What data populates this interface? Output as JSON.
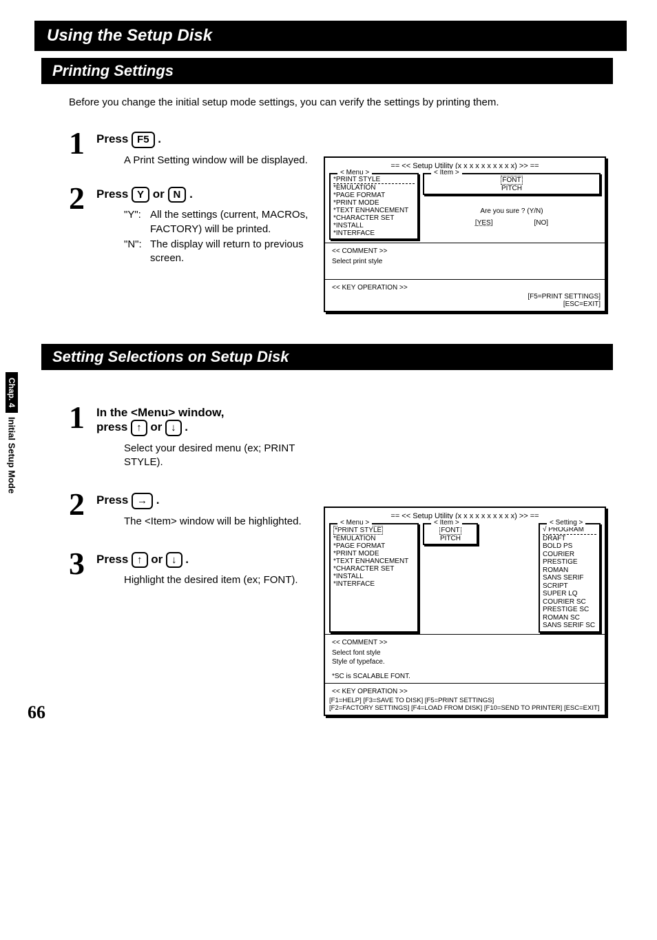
{
  "header": {
    "title": "Using the Setup Disk"
  },
  "sideTab": {
    "chap": "Chap. 4",
    "section": "Initial Setup Mode"
  },
  "pageNumber": "66",
  "section1": {
    "title": "Printing Settings",
    "intro": "Before you change the initial setup mode settings, you can verify the settings by printing them.",
    "step1": {
      "num": "1",
      "headPrefix": "Press ",
      "key": "F5",
      "headSuffix": " .",
      "desc": "A Print Setting window will be displayed."
    },
    "step2": {
      "num": "2",
      "headPrefix": "Press ",
      "keyY": "Y",
      "or": " or ",
      "keyN": "N",
      "headSuffix": " .",
      "rows": [
        {
          "k": "\"Y\":",
          "v": "All the settings (current, MACROs, FACTORY) will be printed."
        },
        {
          "k": "\"N\":",
          "v": "The display will return to previous screen."
        }
      ]
    },
    "screenshot": {
      "title": "==  <<  Setup Utility (x x x x x x   x x x x) >>  ==",
      "menuLabel": "< Menu >",
      "itemLabel": "< Item >",
      "menuItems": [
        "*PRINT STYLE",
        "*EMULATION",
        "*PAGE FORMAT",
        "*PRINT MODE",
        "*TEXT ENHANCEMENT",
        "*CHARACTER SET",
        "*INSTALL",
        "*INTERFACE"
      ],
      "itemItems": [
        "FONT",
        "PITCH"
      ],
      "prompt": "Are you sure ?  (Y/N)",
      "yes": "[YES]",
      "no": "[NO]",
      "commentLabel": "<< COMMENT >>",
      "commentText": "Select print style",
      "keyopLabel": "<< KEY OPERATION >>",
      "keyRight1": "[F5=PRINT SETTINGS]",
      "keyRight2": "[ESC=EXIT]"
    }
  },
  "section2": {
    "title": "Setting Selections on Setup Disk",
    "step1": {
      "num": "1",
      "line1a": "In the <Menu> window,",
      "line2prefix": "press ",
      "arrowUp": "↑",
      "or": " or  ",
      "arrowDown": "↓",
      "suffix": " .",
      "desc": "Select your desired menu (ex; PRINT STYLE)."
    },
    "step2": {
      "num": "2",
      "prefix": "Press ",
      "arrowRight": "→",
      "suffix": " .",
      "desc": "The <Item> window will be highlighted."
    },
    "step3": {
      "num": "3",
      "prefix": "Press ",
      "arrowUp": "↑",
      "or": " or ",
      "arrowDown": "↓",
      "suffix": " .",
      "desc": "Highlight the desired item (ex; FONT)."
    },
    "screenshot": {
      "title": "==  <<  Setup Utility (x x x x x x   x x x x) >>  ==",
      "menuLabel": "< Menu >",
      "itemLabel": "< Item >",
      "settingLabel": "< Setting >",
      "menuItems": [
        "*PRINT STYLE",
        "*EMULATION",
        "*PAGE FORMAT",
        "*PRINT MODE",
        "*TEXT ENHANCEMENT",
        "*CHARACTER SET",
        "*INSTALL",
        "*INTERFACE"
      ],
      "itemItems": [
        "FONT",
        "PITCH"
      ],
      "settingItems": [
        "√ PROGRAM",
        "DRAFT",
        "BOLD PS",
        "COURIER",
        "PRESTIGE",
        "ROMAN",
        "SANS SERIF",
        "SCRIPT",
        "SUPER LQ",
        "COURIER SC",
        "PRESTIGE SC",
        "ROMAN SC",
        "SANS SERIF SC"
      ],
      "commentLabel": "<< COMMENT >>",
      "commentLine1": "Select font style",
      "commentLine2": "Style of typeface.",
      "note": "*SC is SCALABLE FONT.",
      "keyopLabel": "<< KEY OPERATION >>",
      "keyLine1": "[F1=HELP]                         [F3=SAVE TO DISK]        [F5=PRINT SETTINGS]",
      "keyLine2": "[F2=FACTORY SETTINGS]  [F4=LOAD FROM DISK]  [F10=SEND TO PRINTER]  [ESC=EXIT]"
    }
  }
}
